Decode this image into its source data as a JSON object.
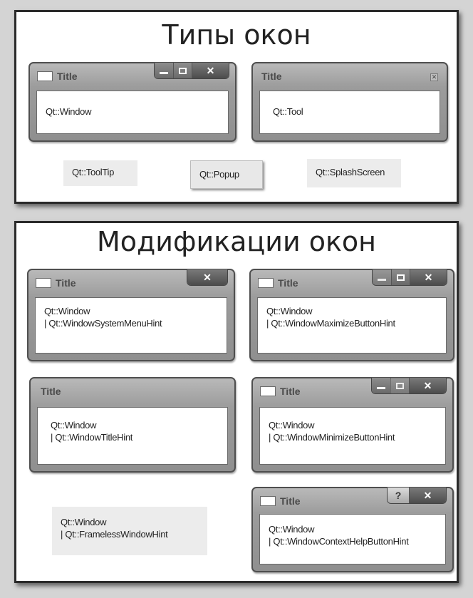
{
  "types_panel": {
    "title": "Типы окон",
    "windows": {
      "window": {
        "title": "Title",
        "body": "Qt::Window",
        "controls": [
          "minimize-icon",
          "maximize-icon",
          "close-icon"
        ]
      },
      "tool": {
        "title": "Title",
        "body": "Qt::Tool",
        "controls": [
          "close-icon"
        ]
      }
    },
    "labels": {
      "tooltip": "Qt::ToolTip",
      "popup": "Qt::Popup",
      "splash": "Qt::SplashScreen"
    }
  },
  "mods_panel": {
    "title": "Модификации окон",
    "windows": {
      "system_menu": {
        "title": "Title",
        "line1": "Qt::Window",
        "line2": "| Qt::WindowSystemMenuHint",
        "controls": [
          "close-icon"
        ]
      },
      "maximize": {
        "title": "Title",
        "line1": "Qt::Window",
        "line2": "| Qt::WindowMaximizeButtonHint",
        "controls": [
          "minimize-icon",
          "maximize-icon",
          "close-icon"
        ]
      },
      "title_hint": {
        "title": "Title",
        "line1": "Qt::Window",
        "line2": "| Qt::WindowTitleHint",
        "controls": []
      },
      "minimize": {
        "title": "Title",
        "line1": "Qt::Window",
        "line2": "| Qt::WindowMinimizeButtonHint",
        "controls": [
          "minimize-icon",
          "maximize-icon",
          "close-icon"
        ]
      },
      "context_help": {
        "title": "Title",
        "line1": "Qt::Window",
        "line2": "| Qt::WindowContextHelpButtonHint",
        "controls": [
          "help-icon",
          "close-icon"
        ]
      }
    },
    "frameless": {
      "line1": "Qt::Window",
      "line2": "| Qt::FramelessWindowHint"
    }
  },
  "glyphs": {
    "close": "✕",
    "help": "?"
  }
}
